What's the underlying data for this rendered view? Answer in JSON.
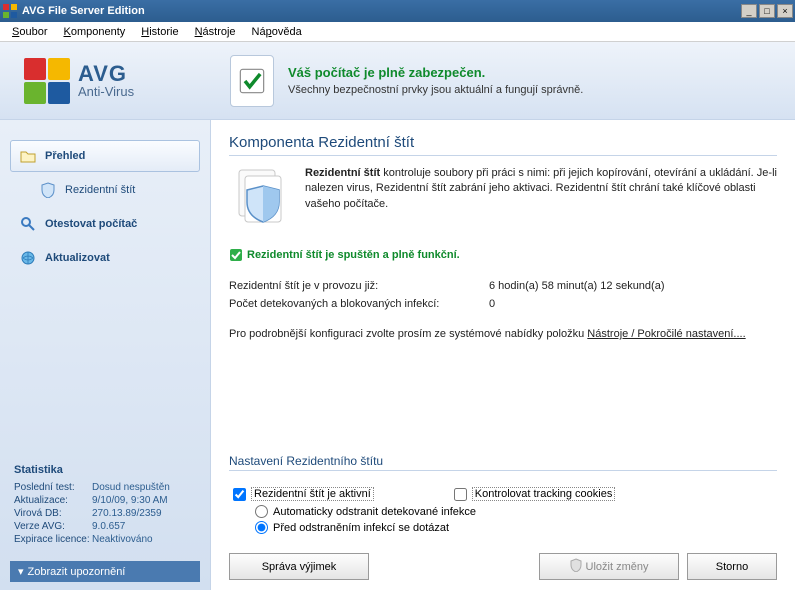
{
  "window": {
    "title": "AVG File Server Edition"
  },
  "menu": {
    "items": [
      "Soubor",
      "Komponenty",
      "Historie",
      "Nástroje",
      "Nápověda"
    ]
  },
  "logo": {
    "brand": "AVG",
    "sub": "Anti-Virus"
  },
  "status": {
    "title": "Váš počítač je plně zabezpečen.",
    "subtitle": "Všechny bezpečnostní prvky jsou aktuální a fungují správně."
  },
  "sidebar": {
    "items": [
      {
        "label": "Přehled"
      },
      {
        "label": "Rezidentní štít"
      },
      {
        "label": "Otestovat počítač"
      },
      {
        "label": "Aktualizovat"
      }
    ],
    "show_notifications": "Zobrazit upozornění"
  },
  "statistics": {
    "heading": "Statistika",
    "rows": [
      {
        "label": "Poslední test:",
        "value": "Dosud nespuštěn"
      },
      {
        "label": "Aktualizace:",
        "value": "9/10/09, 9:30 AM"
      },
      {
        "label": "Virová DB:",
        "value": "270.13.89/2359"
      },
      {
        "label": "Verze AVG:",
        "value": "9.0.657"
      },
      {
        "label": "Expirace licence:",
        "value": "Neaktivováno"
      }
    ]
  },
  "content": {
    "heading": "Komponenta Rezidentní štít",
    "description_bold": "Rezidentní štít",
    "description": " kontroluje soubory při práci s nimi: při jejich kopírování, otevírání a ukládání. Je-li nalezen virus, Rezidentní štít zabrání jeho aktivaci. Rezidentní štít chrání také klíčové oblasti vašeho počítače.",
    "status_line": "Rezidentní štít je spuštěn a plně funkční.",
    "uptime_label": "Rezidentní štít je v provozu již:",
    "uptime_value": "6 hodin(a) 58 minut(a) 12 sekund(a)",
    "detected_label": "Počet detekovaných a blokovaných infekcí:",
    "detected_value": "0",
    "hint_pre": "Pro podrobnější konfiguraci zvolte prosím ze systémové nabídky položku ",
    "hint_link": "Nástroje / Pokročilé nastavení....",
    "settings_heading": "Nastavení Rezidentního štítu",
    "active_label": "Rezidentní štít je aktivní",
    "radio_auto": "Automaticky odstranit detekované infekce",
    "radio_ask": "Před odstraněním infekcí se dotázat",
    "cookies_label": "Kontrolovat tracking cookies",
    "btn_exceptions": "Správa výjimek",
    "btn_save": "Uložit změny",
    "btn_cancel": "Storno"
  }
}
